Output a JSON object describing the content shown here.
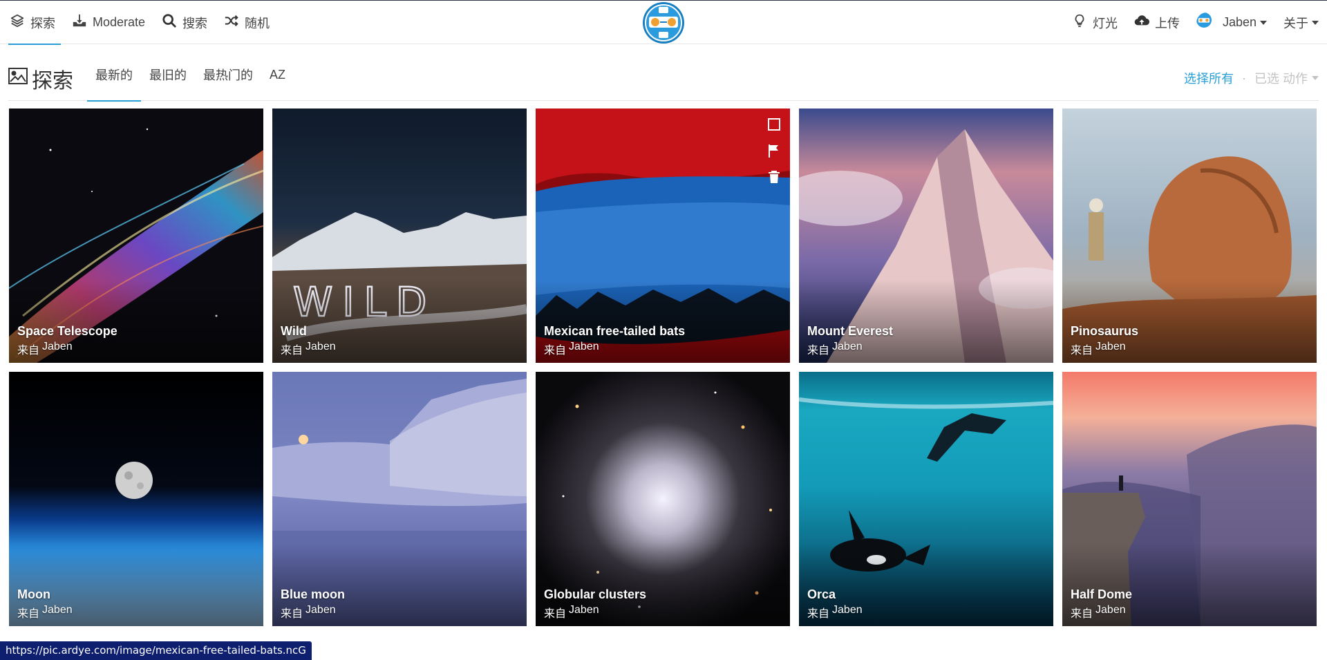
{
  "nav": {
    "left": [
      {
        "label": "探索",
        "icon": "layers-icon"
      },
      {
        "label": "Moderate",
        "icon": "inbox-download-icon"
      },
      {
        "label": "搜索",
        "icon": "search-icon"
      },
      {
        "label": "随机",
        "icon": "shuffle-icon"
      }
    ],
    "right": {
      "lights": "灯光",
      "upload": "上传",
      "user": "Jaben",
      "about": "关于"
    },
    "logo": "site-logo"
  },
  "page": {
    "title": "探索",
    "tabs": [
      "最新的",
      "最旧的",
      "最热门的",
      "AZ"
    ],
    "active_tab": "最新的",
    "select_all": "选择所有",
    "separator": "·",
    "selected_action": "已选 动作"
  },
  "images": [
    {
      "title": "Space Telescope",
      "by": "来自",
      "author": "Jaben"
    },
    {
      "title": "Wild",
      "by": "来自",
      "author": "Jaben"
    },
    {
      "title": "Mexican free-tailed bats",
      "by": "来自",
      "author": "Jaben"
    },
    {
      "title": "Mount Everest",
      "by": "来自",
      "author": "Jaben"
    },
    {
      "title": "Pinosaurus",
      "by": "来自",
      "author": "Jaben"
    },
    {
      "title": "Moon",
      "by": "来自",
      "author": "Jaben"
    },
    {
      "title": "Blue moon",
      "by": "来自",
      "author": "Jaben"
    },
    {
      "title": "Globular clusters",
      "by": "来自",
      "author": "Jaben"
    },
    {
      "title": "Orca",
      "by": "来自",
      "author": "Jaben"
    },
    {
      "title": "Half Dome",
      "by": "来自",
      "author": "Jaben"
    }
  ],
  "status_url": "https://pic.ardye.com/image/mexican-free-tailed-bats.ncG",
  "colors": {
    "accent": "#2a9fd6",
    "status_bg": "#0d1f6e"
  }
}
